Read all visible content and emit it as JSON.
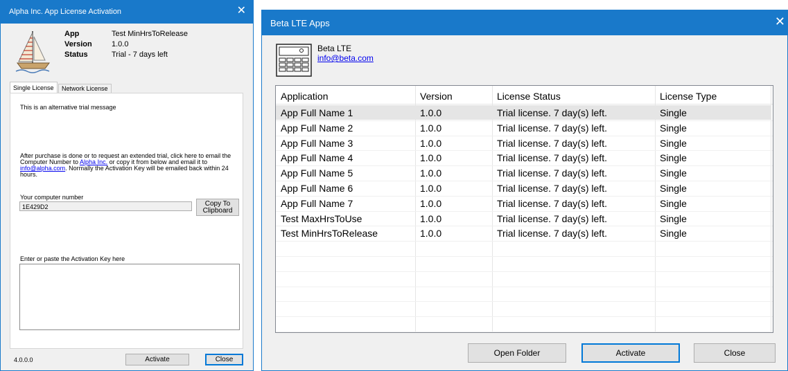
{
  "win1": {
    "title": "Alpha Inc. App License Activation",
    "close_glyph": "✕",
    "info": {
      "app_label": "App",
      "app_value": "Test MinHrsToRelease",
      "version_label": "Version",
      "version_value": "1.0.0",
      "status_label": "Status",
      "status_value": "Trial - 7 days left"
    },
    "tabs": [
      "Single License",
      "Network License"
    ],
    "message": "This is an alternative trial message",
    "instructions": {
      "line1": "After purchase is done or to request an extended trial, click here to email the",
      "line2_a": "Computer Number to ",
      "line2_link": "Alpha Inc.",
      "line2_b": " or copy it from below and email it to",
      "line3_link": "info@alpha.com",
      "line3_b": ". Normally the Activation Key will be emailed back within 24",
      "line4": "hours."
    },
    "computer_number_label": "Your computer number",
    "computer_number_value": "1E429D2",
    "copy_button_line1": "Copy To",
    "copy_button_line2": "Clipboard",
    "activation_key_label": "Enter or paste the Activation Key here",
    "activation_key_value": "",
    "version_footer": "4.0.0.0",
    "activate_label": "Activate",
    "close_label": "Close"
  },
  "win2": {
    "title": "Beta LTE Apps",
    "close_glyph": "✕",
    "company": "Beta LTE",
    "email": "info@beta.com",
    "columns": [
      "Application",
      "Version",
      "License Status",
      "License Type"
    ],
    "rows": [
      [
        "App Full Name 1",
        "1.0.0",
        "Trial license. 7 day(s) left.",
        "Single"
      ],
      [
        "App Full Name 2",
        "1.0.0",
        "Trial license. 7 day(s) left.",
        "Single"
      ],
      [
        "App Full Name 3",
        "1.0.0",
        "Trial license. 7 day(s) left.",
        "Single"
      ],
      [
        "App Full Name 4",
        "1.0.0",
        "Trial license. 7 day(s) left.",
        "Single"
      ],
      [
        "App Full Name 5",
        "1.0.0",
        "Trial license. 7 day(s) left.",
        "Single"
      ],
      [
        "App Full Name 6",
        "1.0.0",
        "Trial license. 7 day(s) left.",
        "Single"
      ],
      [
        "App Full Name 7",
        "1.0.0",
        "Trial license. 7 day(s) left.",
        "Single"
      ],
      [
        "Test MaxHrsToUse",
        "1.0.0",
        "Trial license. 7 day(s) left.",
        "Single"
      ],
      [
        "Test MinHrsToRelease",
        "1.0.0",
        "Trial license. 7 day(s) left.",
        "Single"
      ]
    ],
    "open_folder_label": "Open Folder",
    "activate_label": "Activate",
    "close_label": "Close"
  }
}
